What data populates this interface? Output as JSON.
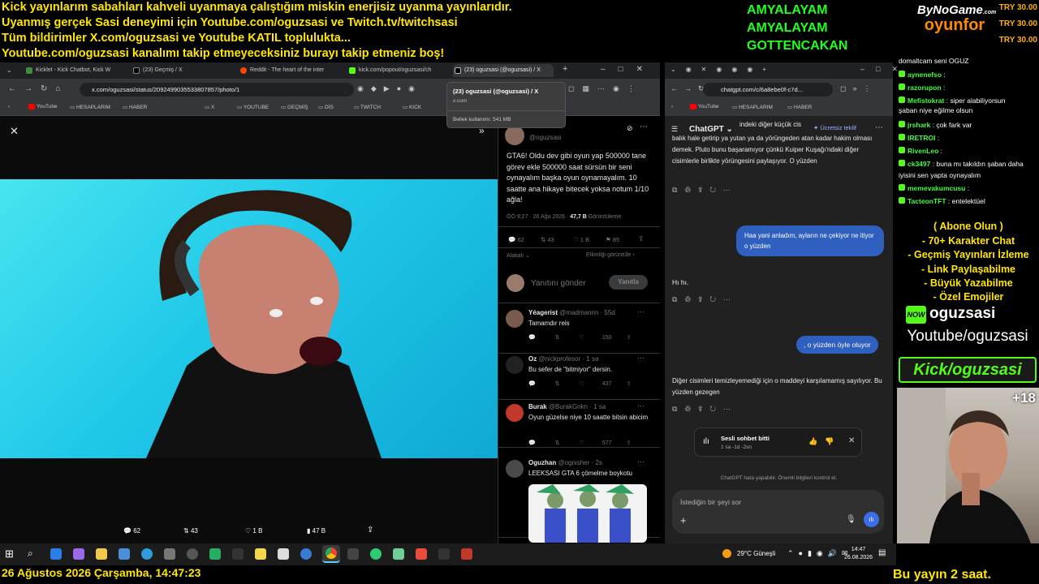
{
  "banner": [
    "Kick yayınlarım sabahları kahveli uyanmaya çalıştığım miskin enerjisiz uyanma yayınlarıdır.",
    "Uyanmış gerçek Sasi deneyimi için Youtube.com/oguzsasi ve Twitch.tv/twitchsasi",
    "Tüm bildirimler X.com/oguzsasi ve Youtube KATIL toplulukta...",
    "Youtube.com/oguzsasi kanalımı takip etmeyeceksiniz burayı takip etmeniz boş!"
  ],
  "donors": [
    "AMYALAYAM",
    "AMYALAYAM",
    "GOTTENCAKAN"
  ],
  "sponsor": {
    "brand_top": "ByNoGame",
    "brand_sub": ".com",
    "brand_main": "oyunfor",
    "prices": [
      "TRY 30.00",
      "TRY 30.00",
      "TRY 30.00"
    ]
  },
  "browser_left": {
    "tabs": [
      "Kicklet - Kick Chatbot, Kick W",
      "(23) Geçmiş / X",
      "Reddit - The heart of the inter",
      "kick.com/popout/oguzsasi/ch",
      "(23) oguzsasi (@oguzsasi) / X"
    ],
    "url": "x.com/oguzsasi/status/2092499035533807857/photo/1",
    "bookmarks": [
      "YouTube",
      "HESAPLARIM",
      "HABER",
      "X",
      "YOUTUBE",
      "GEÇMİŞ",
      "DİS",
      "TWITCH",
      "KICK"
    ],
    "tooltip": {
      "title": "(23) oguzsasi (@oguzsasi) / X",
      "domain": "x.com",
      "memory": "Bellek kullanımı: 541 MB"
    }
  },
  "photo_actions": {
    "replies": "62",
    "reposts": "43",
    "likes": "1 B",
    "views": "47 B"
  },
  "tweet": {
    "handle": "@oguzsasi",
    "text": "GTA6! Oldu dev gibi oyun yap 500000 tane görev ekle 500000 saat sürsün bir seni oynayalım başka oyun oynamayalım. 10 saatte ana hikaye bitecek yoksa notum 1/10 ağla!",
    "meta_time": "ÖÖ 9:27 · 26 Ağu 2026 · ",
    "meta_views": "47,7 B",
    "meta_views_label": " Görüntüleme",
    "stats": {
      "replies": "62",
      "reposts": "43",
      "likes": "1 B",
      "bookmarks": "85"
    },
    "related_left": "Alakalı",
    "related_right": "Etkinliği görüntüle",
    "reply_placeholder": "Yanıtını gönder",
    "reply_button": "Yanıtla"
  },
  "replies": [
    {
      "name": "Yéagerist",
      "handle": "@madmanrin · 55d",
      "text": "Tamamdır reis",
      "views": "150"
    },
    {
      "name": "Oz",
      "handle": "@nickprofesor · 1 sa",
      "text": "Bu sefer de \"bitmiyor\" dersin.",
      "views": "437"
    },
    {
      "name": "Burak",
      "handle": "@BurakGnkn · 1 sa",
      "text": "Oyun güzelse niye 10 saatte bitsin abicim",
      "views": "577"
    },
    {
      "name": "Oguzhan",
      "handle": "@ognisher · 2s",
      "text": "LEEKSASI GTA 6 çömelme boykotu",
      "views": ""
    }
  ],
  "browser_right": {
    "url": "chatgpt.com/c/6a8ebe0f-c7d...",
    "bookmarks": [
      "YouTube",
      "HESAPLARIM",
      "HABER"
    ]
  },
  "chatgpt": {
    "title": "ChatGPT",
    "offer": "Ücretsiz teklif",
    "frag_top": "indeki diğer küçük cis",
    "msg1": "balık hale getirip ya yutan ya da yörüngeden atan kadar hakim olması demek. Pluto bunu başaramıyor çünkü Kuiper Kuşağı'ndaki diğer cisimlerle birlikte yörüngesini paylaşıyor. O yüzden",
    "user1": "Haa yani anladım, ayların ne çekiyor ne itiyor o yüzden",
    "msg2": "Hı hı.",
    "user2": ", o yüzden öyle oluyor",
    "msg3": "Diğer cisimleri temizleyemediği için o maddeyi karşılamamış sayılıyor. Bu yüzden gezegen",
    "voice_title": "Sesli sohbet bitti",
    "voice_sub": "1 sa -1d -2sn",
    "disclaimer": "ChatGPT hata yapabilir. Önemli bilgileri kontrol et.",
    "input_placeholder": "İstediğin bir şeyi sor"
  },
  "kick_chat": [
    {
      "user": "",
      "text": "domaltcam seni OGUZ"
    },
    {
      "user": "aynenefso",
      "text": ":"
    },
    {
      "user": "razorupon",
      "text": ":"
    },
    {
      "user": "Mefistokrat",
      "text": ": siper alabiliyorsun"
    },
    {
      "user": "",
      "text": "şaban niye eğilme olsun"
    },
    {
      "user": "jrshark",
      "text": ": çok fark var"
    },
    {
      "user": "IRETROI",
      "text": ":"
    },
    {
      "user": "RivenLeo",
      "text": ":"
    },
    {
      "user": "ck3497",
      "text": ": buna mı takıldın şaban daha"
    },
    {
      "user": "",
      "text": "iyisini sen yapta oynayalım"
    },
    {
      "user": "memevakumcusu",
      "text": ":"
    },
    {
      "user": "TacteonTFT",
      "text": ": entelektüel"
    }
  ],
  "ad_lines": [
    "( Abone Olun )",
    "- 70+ Karakter Chat",
    "- Geçmiş Yayınları İzleme",
    "- Link Paylaşabilme",
    "- Büyük Yazabilme",
    "- Özel Emojiler"
  ],
  "socials": {
    "now_badge": "NOW",
    "now_name": "oguzsasi",
    "youtube": "Youtube/oguzsasi",
    "kick": "Kick/oguzsasi",
    "age": "+18"
  },
  "taskbar": {
    "weather": "29°C  Güneşli",
    "time": "14:47",
    "date": "26.08.2026"
  },
  "footer": {
    "datetime": "26 Ağustos 2026 Çarşamba, 14:47:23",
    "ticker": "Bu yayın 2 saat."
  },
  "colors": {
    "banner": "#ffe600",
    "donor": "#20ff20",
    "chat_user": "#40ff40",
    "user_bubble": "#2f5fbf"
  }
}
